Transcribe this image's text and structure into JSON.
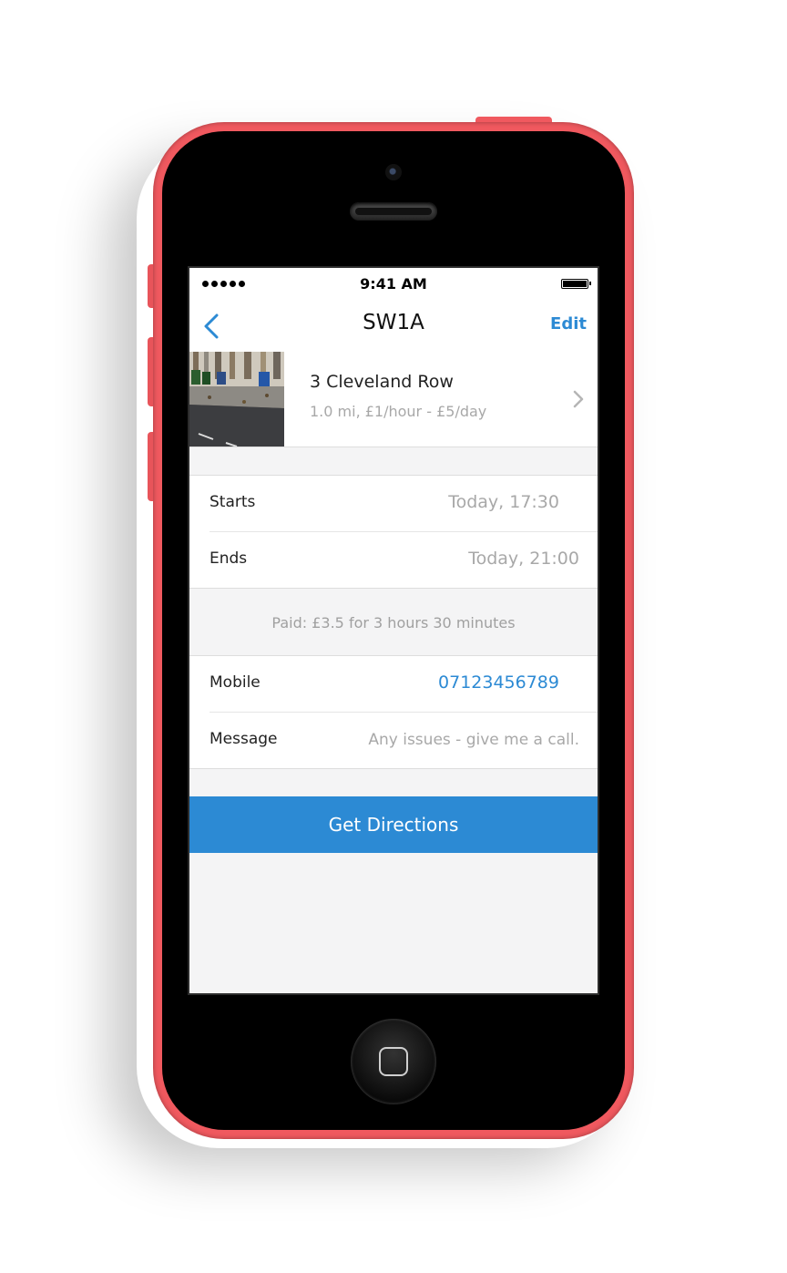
{
  "status_bar": {
    "time": "9:41 AM"
  },
  "nav": {
    "title": "SW1A",
    "edit_label": "Edit",
    "back_icon": "chevron-left-icon"
  },
  "listing": {
    "title": "3 Cleveland Row",
    "subtitle": "1.0 mi, £1/hour - £5/day",
    "chevron_icon": "chevron-right-icon"
  },
  "booking": {
    "starts_label": "Starts",
    "starts_value": "Today, 17:30",
    "ends_label": "Ends",
    "ends_value": "Today, 21:00",
    "paid_note": "Paid: £3.5 for 3 hours 30 minutes"
  },
  "contact": {
    "mobile_label": "Mobile",
    "mobile_value": "07123456789",
    "message_label": "Message",
    "message_value": "Any issues - give me a call."
  },
  "cta": {
    "label": "Get Directions"
  },
  "colors": {
    "accent": "#2c8ad4",
    "phone_case": "#f0595f",
    "background": "#f4f4f5",
    "muted_text": "#a8a8a8"
  }
}
